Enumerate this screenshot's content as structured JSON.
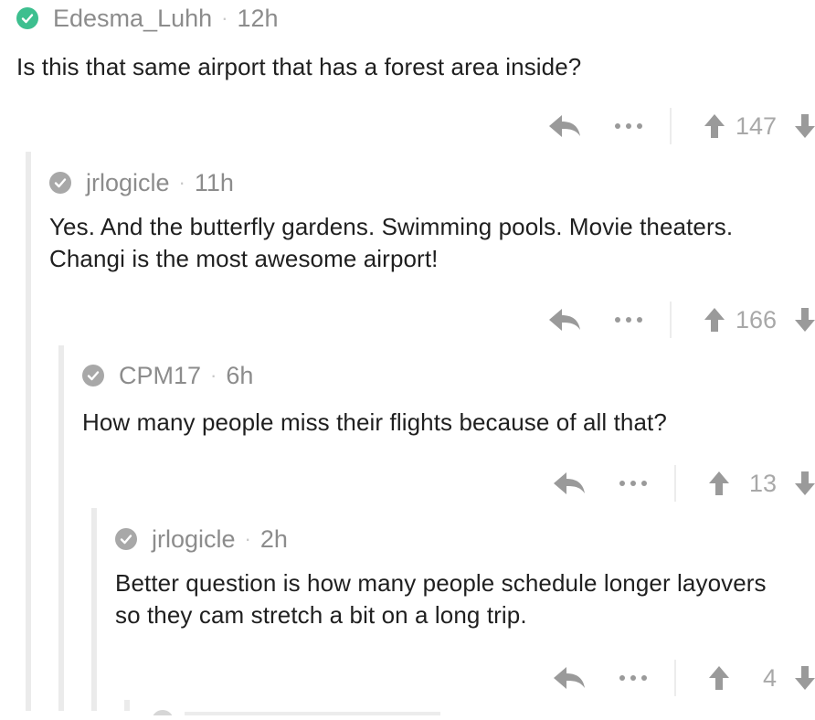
{
  "colors": {
    "verified_green": "#3dbf8f",
    "neutral_check": "#a8a8a8",
    "meta_gray": "#8c8c8c",
    "thread_line": "#ebebeb"
  },
  "comments": [
    {
      "username": "Edesma_Luhh",
      "age": "12h",
      "text": "Is this that same airport that has a forest area inside?",
      "score": "147",
      "badge_icon": "verified-check-icon"
    },
    {
      "username": "jrlogicle",
      "age": "11h",
      "text": "Yes. And the butterfly gardens. Swimming pools. Movie theaters. Changi is the most awesome airport!",
      "score": "166",
      "badge_icon": "check-icon"
    },
    {
      "username": "CPM17",
      "age": "6h",
      "text": "How many people miss their flights because of all that?",
      "score": "13",
      "badge_icon": "check-icon"
    },
    {
      "username": "jrlogicle",
      "age": "2h",
      "text": "Better question is how many people schedule longer layovers so they cam stretch a bit on a long trip.",
      "score": "4",
      "badge_icon": "check-icon"
    }
  ],
  "separator": "·"
}
